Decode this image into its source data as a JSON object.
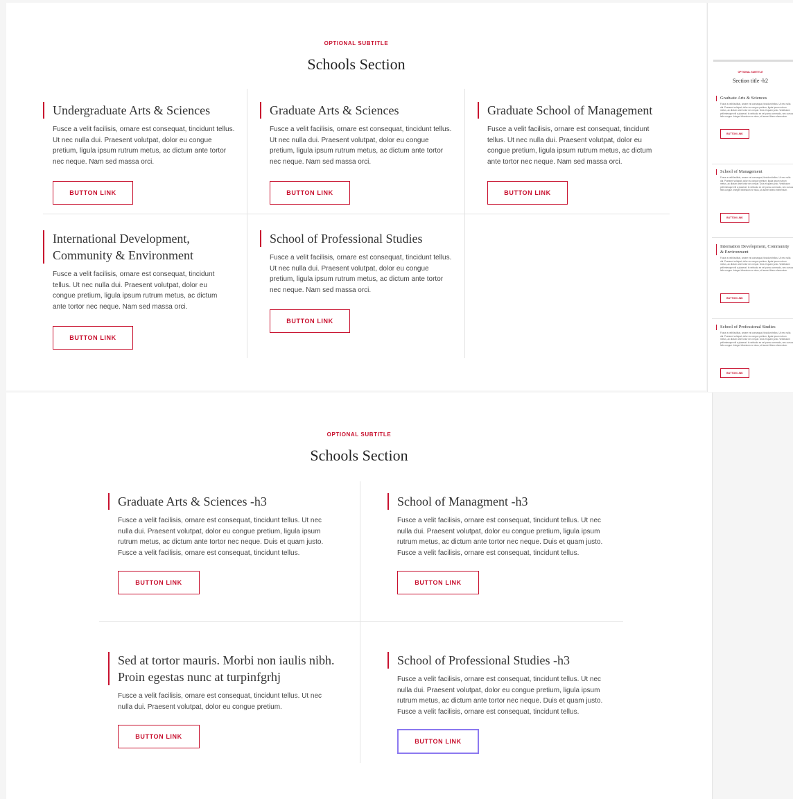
{
  "colors": {
    "accent": "#c8102e",
    "focus": "#8b78f0"
  },
  "section1": {
    "subtitle": "OPTIONAL SUBTITLE",
    "title": "Schools Section",
    "cards": [
      {
        "title": "Undergraduate Arts & Sciences",
        "body": "Fusce a velit facilisis, ornare est consequat, tincidunt tellus. Ut nec nulla dui. Praesent volutpat, dolor eu congue pretium, ligula ipsum rutrum metus, ac dictum ante tortor nec neque. Nam sed massa orci.",
        "button": "BUTTON LINK"
      },
      {
        "title": "Graduate Arts & Sciences",
        "body": "Fusce a velit facilisis, ornare est consequat, tincidunt tellus. Ut nec nulla dui. Praesent volutpat, dolor eu congue pretium, ligula ipsum rutrum metus, ac dictum ante tortor nec neque. Nam sed massa orci.",
        "button": "BUTTON LINK"
      },
      {
        "title": "Graduate School of Management",
        "body": "Fusce a velit facilisis, ornare est consequat, tincidunt tellus. Ut nec nulla dui. Praesent volutpat, dolor eu congue pretium, ligula ipsum rutrum metus, ac dictum ante tortor nec neque. Nam sed massa orci.",
        "button": "BUTTON LINK"
      },
      {
        "title": "International Development, Community & Environment",
        "body": "Fusce a velit facilisis, ornare est consequat, tincidunt tellus. Ut nec nulla dui. Praesent volutpat, dolor eu congue pretium, ligula ipsum rutrum metus, ac dictum ante tortor nec neque. Nam sed massa orci.",
        "button": "BUTTON LINK"
      },
      {
        "title": "School of Professional Studies",
        "body": "Fusce a velit facilisis, ornare est consequat, tincidunt tellus. Ut nec nulla dui. Praesent volutpat, dolor eu congue pretium, ligula ipsum rutrum metus, ac dictum ante tortor nec neque. Nam sed massa orci.",
        "button": "BUTTON LINK"
      }
    ]
  },
  "mini": {
    "subtitle": "OPTIONAL SUBTITLE",
    "title": "Section title -h2",
    "cards": [
      {
        "title": "Graduate Arts & Sciences",
        "body": "Fusce a velit facilisis, ornare est consequat, tincidunt tellus. Ut nec nulla dui. Praesent volutpat, dolor eu congue pretium, ligula ipsum rutrum metus, ac dictum ante tortor nec neque. Duis et quam justo. Vestibulum pellentesque elit a placerat. In vehicula ex vel purus commodo, nec cursus felis congue. Integer bibendum ne risus, ut laoreet libero elementum.",
        "button": "BUTTON LINK"
      },
      {
        "title": "School of Management",
        "body": "Fusce a velit facilisis, ornare est consequat, tincidunt tellus. Ut nec nulla dui. Praesent volutpat, dolor eu congue pretium, ligula ipsum rutrum metus, ac dictum ante tortor nec neque. Duis et quam justo. Vestibulum pellentesque elit a placerat. In vehicula ex vel purus commodo, nec cursus felis congue. Integer bibendum ne risus, ut laoreet libero elementum.",
        "button": "BUTTON LINK"
      },
      {
        "title": "Internation Development, Community & Environment",
        "body": "Fusce a velit facilisis, ornare est consequat, tincidunt tellus. Ut nec nulla dui. Praesent volutpat, dolor eu congue pretium, ligula ipsum rutrum metus, ac dictum ante tortor nec neque. Duis et quam justo. Vestibulum pellentesque elit a placerat. In vehicula ex vel purus commodo, nec cursus felis congue. Integer bibendum ne risus, ut laoreet libero elementum.",
        "button": "BUTTON LINK"
      },
      {
        "title": "School of Professional Studies",
        "body": "Fusce a velit facilisis, ornare est consequat, tincidunt tellus. Ut nec nulla dui. Praesent volutpat, dolor eu congue pretium, ligula ipsum rutrum metus, ac dictum ante tortor nec neque. Duis et quam justo. Vestibulum pellentesque elit a placerat. In vehicula ex vel purus commodo, nec cursus felis congue. Integer bibendum ne risus, ut laoreet libero elementum.",
        "button": "BUTTON LINK"
      }
    ]
  },
  "section2": {
    "subtitle": "OPTIONAL SUBTITLE",
    "title": "Schools Section",
    "cards": [
      {
        "title": "Graduate Arts & Sciences -h3",
        "body": "Fusce a velit facilisis, ornare est consequat, tincidunt tellus. Ut nec nulla dui. Praesent volutpat, dolor eu congue pretium, ligula ipsum rutrum metus, ac dictum ante tortor nec neque. Duis et quam justo. Fusce a velit facilisis, ornare est consequat, tincidunt tellus.",
        "button": "BUTTON LINK"
      },
      {
        "title": "School of Managment -h3",
        "body": "Fusce a velit facilisis, ornare est consequat, tincidunt tellus. Ut nec nulla dui. Praesent volutpat, dolor eu congue pretium, ligula ipsum rutrum metus, ac dictum ante tortor nec neque. Duis et quam justo. Fusce a velit facilisis, ornare est consequat, tincidunt tellus.",
        "button": "BUTTON LINK"
      },
      {
        "title": "Sed at tortor mauris. Morbi non iaulis nibh. Proin egestas nunc at turpinfgrhj",
        "body": "Fusce a velit facilisis, ornare est consequat, tincidunt tellus. Ut nec nulla dui. Praesent volutpat, dolor eu congue pretium.",
        "button": "BUTTON LINK"
      },
      {
        "title": "School of Professional Studies -h3",
        "body": "Fusce a velit facilisis, ornare est consequat, tincidunt tellus. Ut nec nulla dui. Praesent volutpat, dolor eu congue pretium, ligula ipsum rutrum metus, ac dictum ante tortor nec neque. Duis et quam justo. Fusce a velit facilisis, ornare est consequat, tincidunt tellus.",
        "button": "BUTTON LINK"
      }
    ]
  }
}
